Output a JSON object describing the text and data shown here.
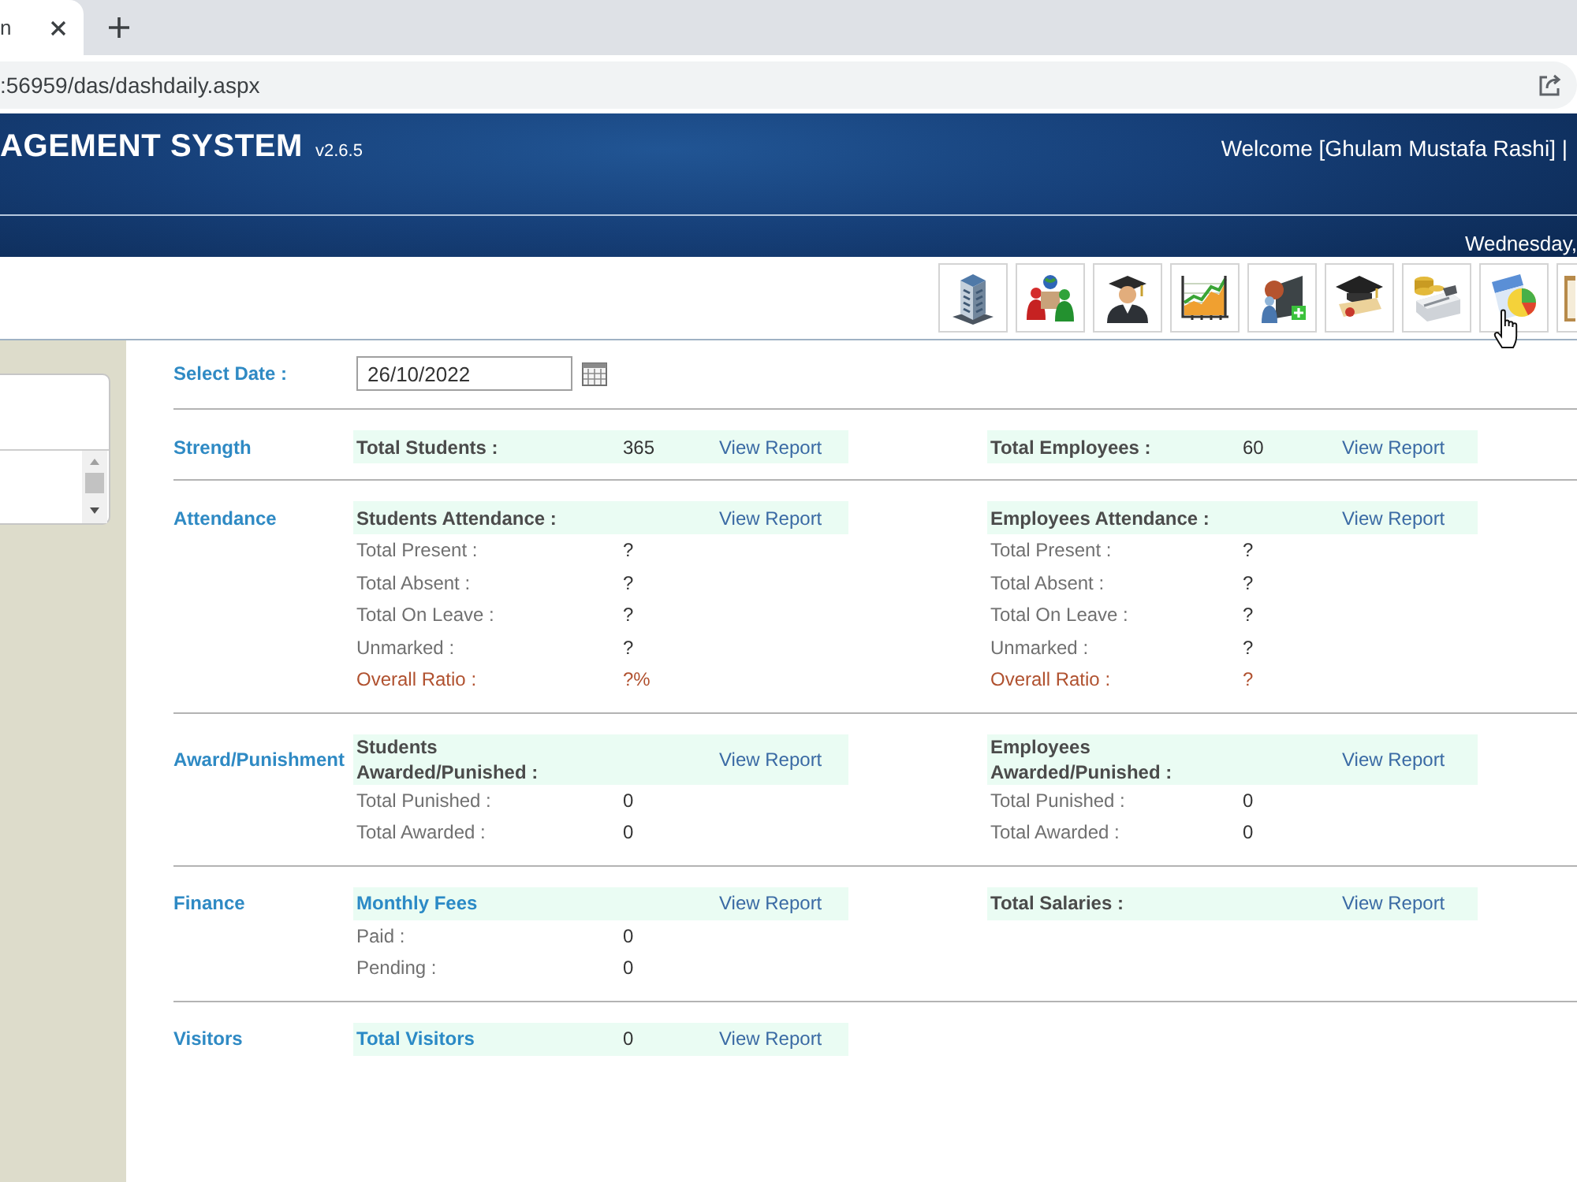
{
  "browser": {
    "tab_title": "n",
    "url": ":56959/das/dashdaily.aspx"
  },
  "header": {
    "title": "AGEMENT SYSTEM",
    "version": "v2.6.5",
    "welcome": "Welcome [Ghulam Mustafa Rashi] |",
    "date": "Wednesday,"
  },
  "date_filter": {
    "label": "Select Date :",
    "value": "26/10/2022"
  },
  "sections": [
    {
      "label": "Strength",
      "groups": [
        {
          "header": {
            "kind": "text",
            "label": "Total Students :",
            "value": "365",
            "link": "View Report"
          }
        },
        {
          "header": {
            "kind": "text",
            "label": "Total Employees :",
            "value": "60",
            "link": "View Report"
          }
        }
      ]
    },
    {
      "label": "Attendance",
      "groups": [
        {
          "header": {
            "kind": "text",
            "label": "Students Attendance :",
            "link": "View Report"
          },
          "rows": [
            {
              "kind": "count",
              "label": "Total Present :",
              "value": "?"
            },
            {
              "kind": "count",
              "label": "Total Absent :",
              "value": "?"
            },
            {
              "kind": "count",
              "label": "Total On Leave :",
              "value": "?"
            },
            {
              "kind": "count",
              "label": "Unmarked :",
              "value": "?"
            },
            {
              "kind": "ratio",
              "label": "Overall Ratio :",
              "value": "?%"
            }
          ]
        },
        {
          "header": {
            "kind": "text",
            "label": "Employees Attendance :",
            "link": "View Report"
          },
          "rows": [
            {
              "kind": "count",
              "label": "Total Present :",
              "value": "?"
            },
            {
              "kind": "count",
              "label": "Total Absent :",
              "value": "?"
            },
            {
              "kind": "count",
              "label": "Total On Leave :",
              "value": "?"
            },
            {
              "kind": "count",
              "label": "Unmarked :",
              "value": "?"
            },
            {
              "kind": "ratio",
              "label": "Overall Ratio :",
              "value": "?"
            }
          ]
        }
      ]
    },
    {
      "label": "Award/Punishment",
      "groups": [
        {
          "header": {
            "kind": "text",
            "label": "Students Awarded/Punished :",
            "link": "View Report"
          },
          "rows": [
            {
              "kind": "count",
              "label": "Total Punished :",
              "value": "0"
            },
            {
              "kind": "count",
              "label": "Total Awarded :",
              "value": "0"
            }
          ]
        },
        {
          "header": {
            "kind": "text",
            "label": "Employees Awarded/Punished :",
            "link": "View Report"
          },
          "rows": [
            {
              "kind": "count",
              "label": "Total Punished :",
              "value": "0"
            },
            {
              "kind": "count",
              "label": "Total Awarded :",
              "value": "0"
            }
          ]
        }
      ]
    },
    {
      "label": "Finance",
      "groups": [
        {
          "header": {
            "kind": "link",
            "label": "Monthly Fees",
            "link": "View Report"
          },
          "rows": [
            {
              "kind": "count",
              "label": "Paid :",
              "value": "0"
            },
            {
              "kind": "count",
              "label": "Pending :",
              "value": "0"
            }
          ]
        },
        {
          "header": {
            "kind": "text",
            "label": "Total Salaries :",
            "link": "View Report"
          }
        }
      ]
    },
    {
      "label": "Visitors",
      "groups": [
        {
          "header": {
            "kind": "link",
            "label": "Total Visitors",
            "value": "0",
            "link": "View Report"
          }
        }
      ]
    }
  ]
}
